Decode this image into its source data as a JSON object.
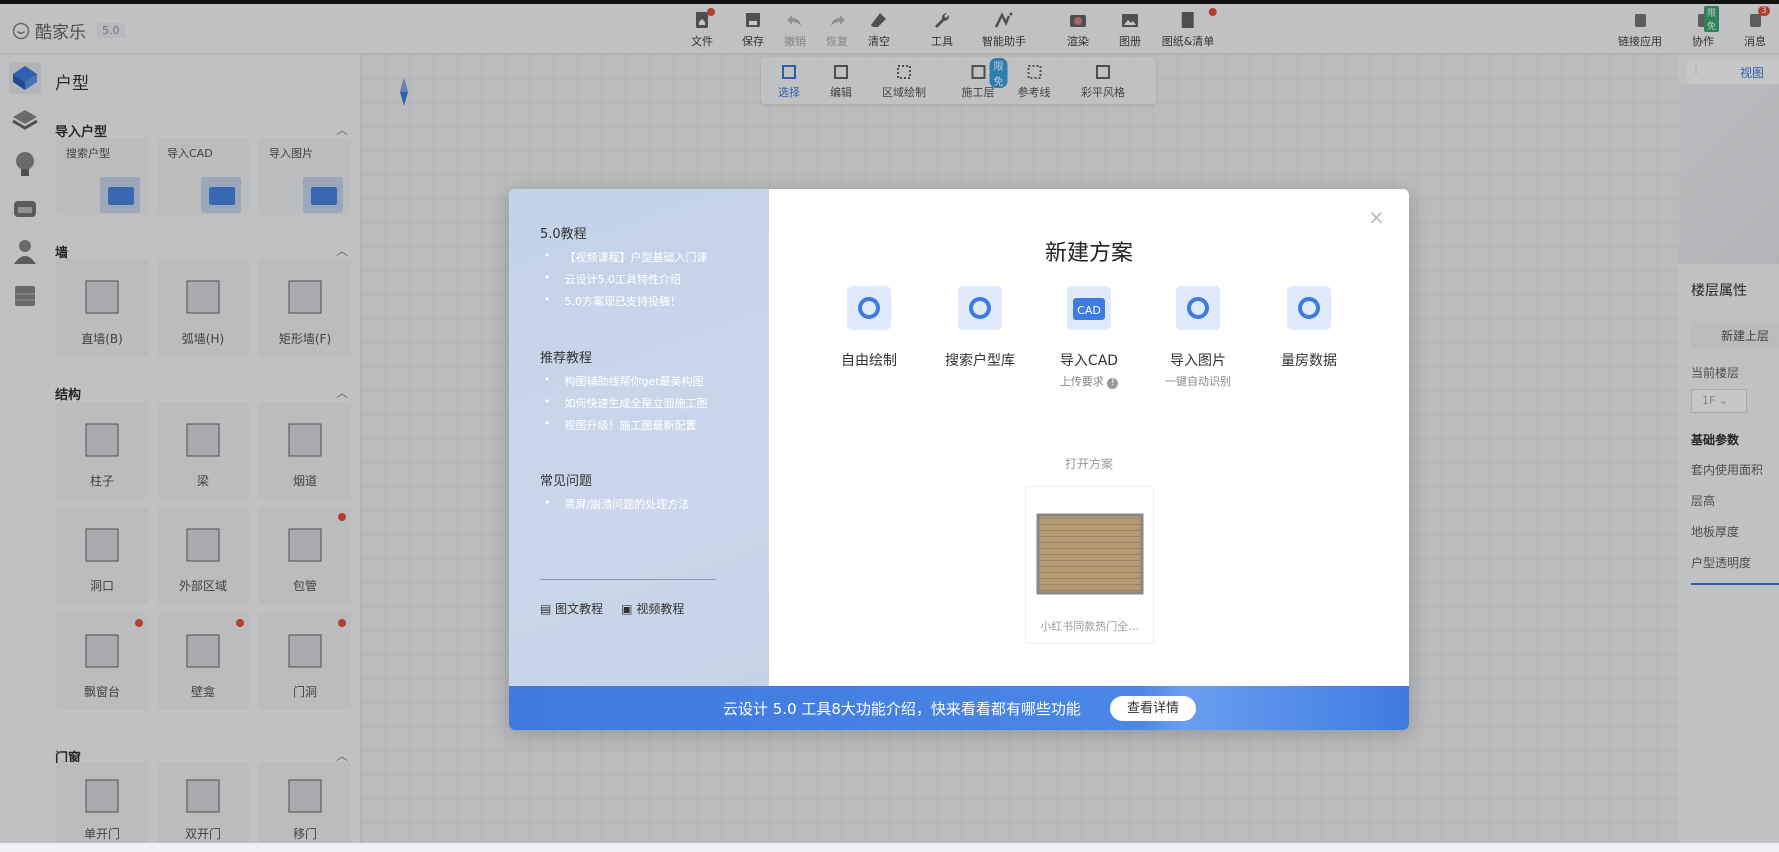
{
  "app": {
    "name": "酷家乐",
    "version": "5.0"
  },
  "toolbar": {
    "items": [
      {
        "label": "文件",
        "icon": "file-home-icon",
        "dot": true,
        "disabled": false
      },
      {
        "label": "保存",
        "icon": "save-icon",
        "disabled": false
      },
      {
        "label": "撤销",
        "icon": "undo-icon",
        "disabled": true
      },
      {
        "label": "恢复",
        "icon": "redo-icon",
        "disabled": true
      },
      {
        "label": "清空",
        "icon": "eraser-icon",
        "disabled": false
      },
      {
        "label": "工具",
        "icon": "wrench-icon",
        "disabled": false
      },
      {
        "label": "智能助手",
        "icon": "ai-icon",
        "disabled": false
      },
      {
        "label": "渲染",
        "icon": "camera-icon",
        "disabled": false
      },
      {
        "label": "图册",
        "icon": "image-icon",
        "disabled": false
      },
      {
        "label": "图纸&清单",
        "icon": "document-icon",
        "dot": true,
        "disabled": false
      }
    ],
    "right": [
      {
        "label": "链接应用",
        "icon": "link-app-icon"
      },
      {
        "label": "协作",
        "icon": "users-icon",
        "badge": "限免"
      },
      {
        "label": "消息",
        "icon": "bell-icon",
        "badge": "3"
      }
    ]
  },
  "subtoolbar": {
    "items": [
      {
        "label": "选择",
        "active": true
      },
      {
        "label": "编辑"
      },
      {
        "label": "区域绘制"
      },
      {
        "label": "施工层",
        "badge": "限免"
      },
      {
        "label": "参考线"
      },
      {
        "label": "彩平风格"
      }
    ]
  },
  "panel": {
    "title": "户型",
    "sections": [
      {
        "title": "导入户型",
        "items": [
          "搜索户型",
          "导入CAD",
          "导入图片"
        ]
      },
      {
        "title": "墙",
        "items": [
          "直墙(B)",
          "弧墙(H)",
          "矩形墙(F)"
        ]
      },
      {
        "title": "结构",
        "items": [
          "柱子",
          "梁",
          "烟道",
          "洞口",
          "外部区域",
          "包管",
          "飘窗台",
          "壁龛",
          "门洞"
        ]
      },
      {
        "title": "门窗",
        "items": [
          "单开门",
          "双开门",
          "移门"
        ]
      }
    ]
  },
  "right_panel": {
    "tab": "视图",
    "floor_title": "楼层属性",
    "new_floor": "新建上层",
    "current_floor_label": "当前楼层",
    "current_floor": "1F",
    "basic_params": "基础参数",
    "params": [
      "套内使用面积",
      "层高",
      "地板厚度",
      "户型透明度"
    ]
  },
  "modal": {
    "title": "新建方案",
    "left": {
      "groups": [
        {
          "title": "5.0教程",
          "items": [
            "【视频课程】户型基础入门课",
            "云设计5.0工具特性介绍",
            "5.0方案现已支持投稿！"
          ]
        },
        {
          "title": "推荐教程",
          "items": [
            "构图辅助线帮你get最美构图",
            "如何快速生成全屋立面施工图",
            "视图升级！施工图最新配置"
          ]
        },
        {
          "title": "常见问题",
          "items": [
            "黑屏/崩溃问题的处理方法"
          ]
        }
      ],
      "links": [
        "图文教程",
        "视频教程"
      ]
    },
    "options": [
      {
        "label": "自由绘制",
        "sub": ""
      },
      {
        "label": "搜索户型库",
        "sub": ""
      },
      {
        "label": "导入CAD",
        "sub": "上传要求"
      },
      {
        "label": "导入图片",
        "sub": "一键自动识别"
      },
      {
        "label": "量房数据",
        "sub": ""
      }
    ],
    "open_label": "打开方案",
    "recent": {
      "name": "小红书同款热门全..."
    },
    "banner": {
      "text": "云设计 5.0 工具8大功能介绍，快来看看都有哪些功能",
      "button": "查看详情"
    }
  },
  "colors": {
    "accent": "#3c7be0",
    "dot": "#e5533d",
    "badge": "#3aa676"
  }
}
